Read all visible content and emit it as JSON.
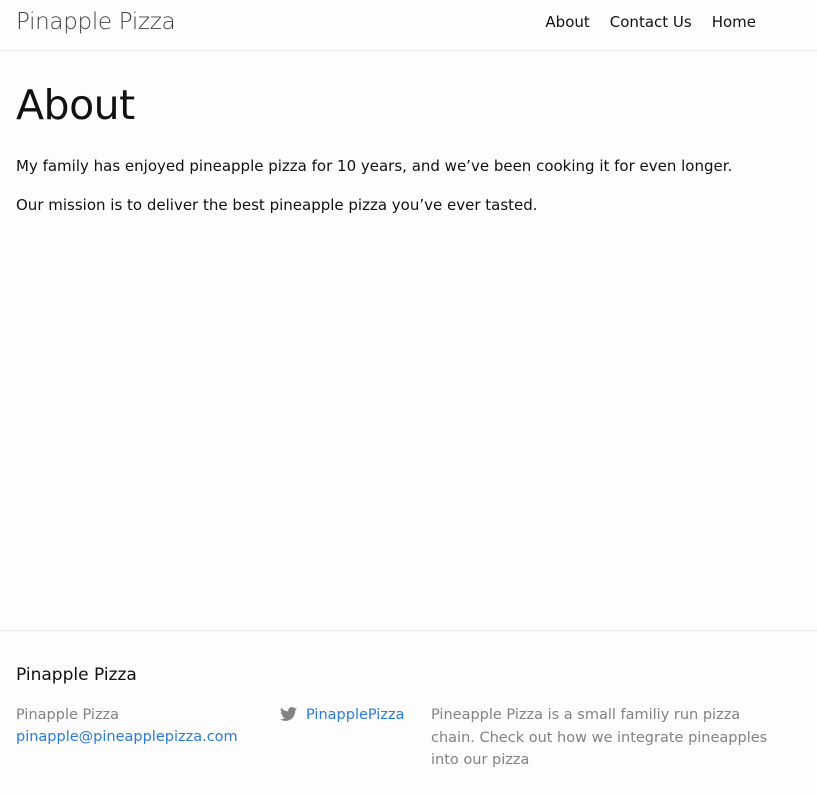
{
  "header": {
    "site_title": "Pinapple Pizza",
    "nav": [
      {
        "label": "About"
      },
      {
        "label": "Contact Us"
      },
      {
        "label": "Home"
      }
    ]
  },
  "main": {
    "title": "About",
    "paragraphs": [
      "My family has enjoyed pineapple pizza for 10 years, and we’ve been cooking it for even longer.",
      "Our mission is to deliver the best pineapple pizza you’ve ever tasted."
    ]
  },
  "footer": {
    "heading": "Pinapple Pizza",
    "contact_name": "Pinapple Pizza",
    "email": "pinapple@pineapplepizza.com",
    "twitter_handle": "PinapplePizza",
    "twitter_icon": "twitter-icon",
    "description": "Pineapple Pizza is a small familiy run pizza chain. Check out how we integrate pineapples into our pizza"
  },
  "colors": {
    "link": "#2a7ae2",
    "muted_text": "#828282",
    "border": "#e8e8e8",
    "background": "#fdfdfd"
  }
}
